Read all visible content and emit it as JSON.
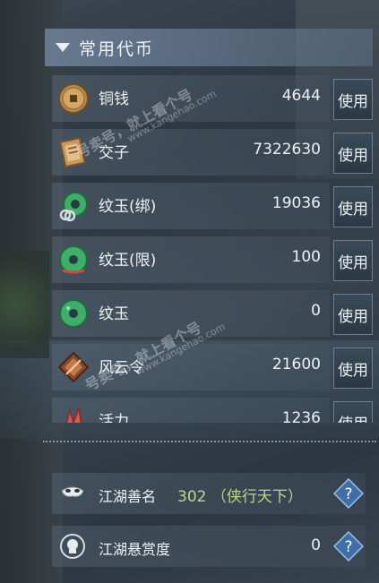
{
  "header": {
    "title": "常用代币"
  },
  "tokens": [
    {
      "name": "铜钱",
      "value": "4644",
      "button": "使用",
      "icon": "copper-coin-icon"
    },
    {
      "name": "交子",
      "value": "7322630",
      "button": "使用",
      "icon": "jiaozi-note-icon"
    },
    {
      "name": "纹玉(绑)",
      "value": "19036",
      "button": "使用",
      "icon": "jade-bound-icon"
    },
    {
      "name": "纹玉(限)",
      "value": "100",
      "button": "使用",
      "icon": "jade-limited-icon"
    },
    {
      "name": "纹玉",
      "value": "0",
      "button": "使用",
      "icon": "jade-icon"
    },
    {
      "name": "风云令",
      "value": "21600",
      "button": "使用",
      "icon": "fengyun-token-icon"
    },
    {
      "name": "活力",
      "value": "1236",
      "button": "使用",
      "icon": "vitality-icon"
    }
  ],
  "stats": [
    {
      "name": "江湖善名",
      "extra": "302 （侠行天下）",
      "value": "",
      "icon": "mask-icon",
      "help": "help-icon"
    },
    {
      "name": "江湖悬赏度",
      "extra": "",
      "value": "0",
      "icon": "bounty-icon",
      "help": "help-icon"
    }
  ],
  "watermarks": [
    {
      "text": "号卖号，就上看个号",
      "url": "www.kangehao.com"
    }
  ]
}
